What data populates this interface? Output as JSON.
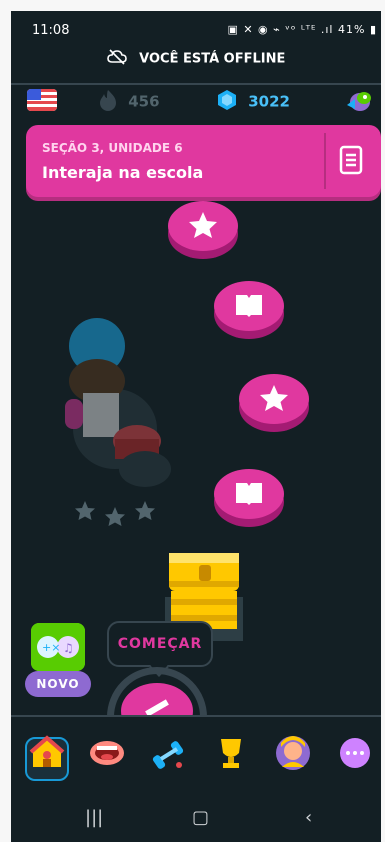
{
  "status_bar": {
    "time": "11:08",
    "indicators": "▣ ✕ ◉ ⌁ ᵛᵒ ᴸᵀᴱ .ıl",
    "battery": "41%"
  },
  "offline_banner": {
    "text": "VOCÊ ESTÁ OFFLINE",
    "icon": "cloud-off-icon"
  },
  "stats": {
    "flag_icon": "us-flag-icon",
    "streak": "456",
    "gems": "3022",
    "extra_icon": "super-duo-icon"
  },
  "unit": {
    "section_label": "SEÇÃO 3, UNIDADE 6",
    "title": "Interaja na escola",
    "guide_icon": "guidebook-icon"
  },
  "path": {
    "nodes": [
      {
        "icon": "star-icon"
      },
      {
        "icon": "book-icon"
      },
      {
        "icon": "star-icon"
      },
      {
        "icon": "book-icon"
      }
    ],
    "chest_icon": "treasure-chest-icon",
    "start_label": "COMEÇAR",
    "current_icon": "dumbbell-icon"
  },
  "new_feature": {
    "badge": "NOVO",
    "icon": "owl-icon"
  },
  "nav": {
    "items": [
      "home-icon",
      "speak-icon",
      "practice-icon",
      "leaderboard-icon",
      "profile-icon",
      "more-icon"
    ]
  },
  "colors": {
    "accent": "#e0389f",
    "accent_dark": "#a41b73",
    "gem": "#49c0f8",
    "bg": "#131f24"
  }
}
